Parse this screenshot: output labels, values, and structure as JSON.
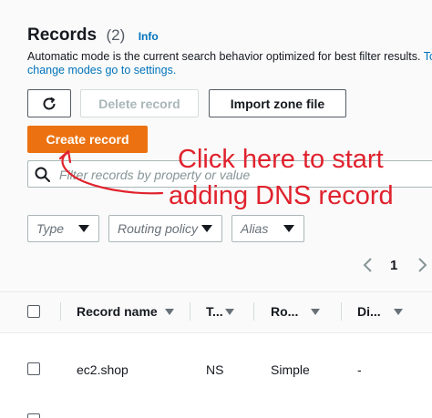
{
  "header": {
    "title": "Records",
    "count": "(2)",
    "info_link": "Info"
  },
  "description": {
    "text": "Automatic mode is the current search behavior optimized for best filter results.",
    "link_to": "To",
    "link_rest": "change modes go to settings."
  },
  "toolbar": {
    "delete_label": "Delete record",
    "import_label": "Import zone file",
    "create_label": "Create record"
  },
  "search": {
    "placeholder": "Filter records by property or value"
  },
  "filters": {
    "type": "Type",
    "routing": "Routing policy",
    "alias": "Alias"
  },
  "pagination": {
    "current_page": "1"
  },
  "table": {
    "columns": [
      "Record name",
      "T...",
      "Ro...",
      "Di..."
    ],
    "rows": [
      {
        "name": "ec2.shop",
        "type": "NS",
        "routing": "Simple",
        "differentiator": "-"
      }
    ]
  },
  "annotation": {
    "line1": "Click here to start",
    "line2": "adding DNS record",
    "color": "#e0222d"
  },
  "colors": {
    "primary": "#ec7211",
    "link": "#0073bb"
  },
  "icons": [
    "refresh-icon",
    "search-icon",
    "chevron-left-icon",
    "chevron-right-icon",
    "caret-down-icon",
    "sort-icon"
  ]
}
